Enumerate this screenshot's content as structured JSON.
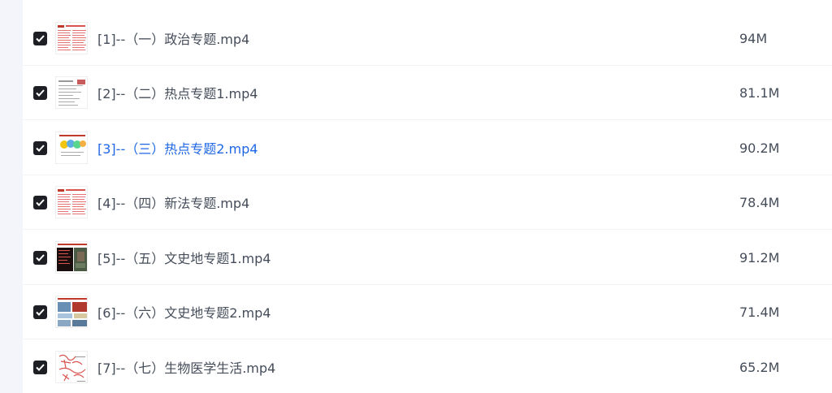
{
  "files": [
    {
      "name": "[1]--（一）政治专题.mp4",
      "size": "94M",
      "checked": true,
      "thumbnail": "thumbnail-document-red"
    },
    {
      "name": "[2]--（二）热点专题1.mp4",
      "size": "81.1M",
      "checked": true,
      "thumbnail": "thumbnail-document-gray"
    },
    {
      "name": "[3]--（三）热点专题2.mp4",
      "size": "90.2M",
      "checked": true,
      "thumbnail": "thumbnail-diagram",
      "highlighted": true
    },
    {
      "name": "[4]--（四）新法专题.mp4",
      "size": "78.4M",
      "checked": true,
      "thumbnail": "thumbnail-document-red"
    },
    {
      "name": "[5]--（五）文史地专题1.mp4",
      "size": "91.2M",
      "checked": true,
      "thumbnail": "thumbnail-photo-dark"
    },
    {
      "name": "[6]--（六）文史地专题2.mp4",
      "size": "71.4M",
      "checked": true,
      "thumbnail": "thumbnail-photo-collage"
    },
    {
      "name": "[7]--（七）生物医学生活.mp4",
      "size": "65.2M",
      "checked": true,
      "thumbnail": "thumbnail-handwriting"
    }
  ],
  "colors": {
    "highlight_text": "#1f67e6",
    "normal_text": "#454d5a",
    "checkbox": "#1d1f24"
  }
}
